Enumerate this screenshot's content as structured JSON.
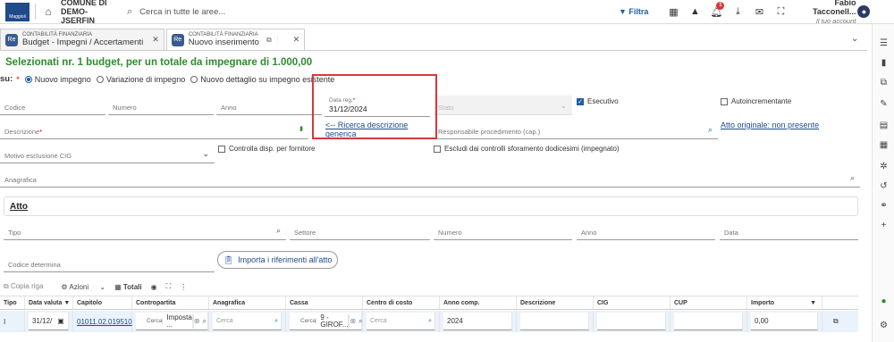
{
  "topbar": {
    "logo_text": "Maggioli",
    "org_line1": "COMUNE DI",
    "org_line2": "DEMO-JSERFIN",
    "search_placeholder": "Cerca in tutte le aree...",
    "filter_label": "Filtra",
    "notification_count": "1",
    "user_name": "Fabio Tacconell...",
    "user_subtitle": "Il tuo account"
  },
  "tabs": [
    {
      "category": "CONTABILITÀ FINANZIARIA",
      "label": "Budget - Impegni / Accertamenti"
    },
    {
      "category": "CONTABILITÀ FINANZIARIA",
      "label": "Nuovo inserimento"
    }
  ],
  "form": {
    "title": "Selezionati nr. 1 budget, per un totale da impegnare di 1.000,00",
    "su_label": "su:",
    "radio_options": [
      "Nuovo impegno",
      "Variazione di impegno",
      "Nuovo dettaglio su impegno esistente"
    ],
    "codice": "Codice",
    "numero": "Numero",
    "anno": "Anno",
    "data_reg_label": "Data reg.",
    "data_reg_value": "31/12/2024",
    "stato": "Stato",
    "esecutivo": "Esecutivo",
    "autoincrementante": "Autoincrementante",
    "descrizione": "Descrizione",
    "ricerca_descr": "<-- Ricerca descrizione generica",
    "responsabile": "Responsabile procedimento (cap.)",
    "atto_originale": "Atto originale: non presente",
    "motivo_cig": "Motivo esclusione CIG",
    "controlla_disp": "Controlla disp. per fornitore",
    "escludi": "Escludi dai controlli sforamento dodicesimi (impegnato)",
    "anagrafica": "Anagrafica"
  },
  "atto": {
    "heading": "Atto",
    "tipo": "Tipo",
    "settore": "Settore",
    "numero": "Numero",
    "anno": "Anno",
    "data": "Data",
    "codice_determina": "Codice determina",
    "import_button": "Importa i riferimenti all'atto"
  },
  "toolbar": {
    "copia_riga": "Copia riga",
    "azioni": "Azioni",
    "totali": "Totali"
  },
  "table": {
    "headers": [
      "Tipo",
      "Data valuta",
      "Capitolo",
      "Contropartita",
      "Anagrafica",
      "Cassa",
      "Centro di costo",
      "Anno comp.",
      "Descrizione",
      "CIG",
      "CUP",
      "Importo"
    ],
    "row": {
      "tipo": "I",
      "data_valuta": "31/12/",
      "capitolo": "01011.02.019510",
      "contropartita_hint": "Cerca",
      "contropartita_value": "Imposta ...",
      "anagrafica": "Cerca",
      "cassa_hint": "Cerca",
      "cassa_value": "9 - GIROF...",
      "centro_costo": "Cerca",
      "anno_comp": "2024",
      "importo": "0,00"
    }
  }
}
